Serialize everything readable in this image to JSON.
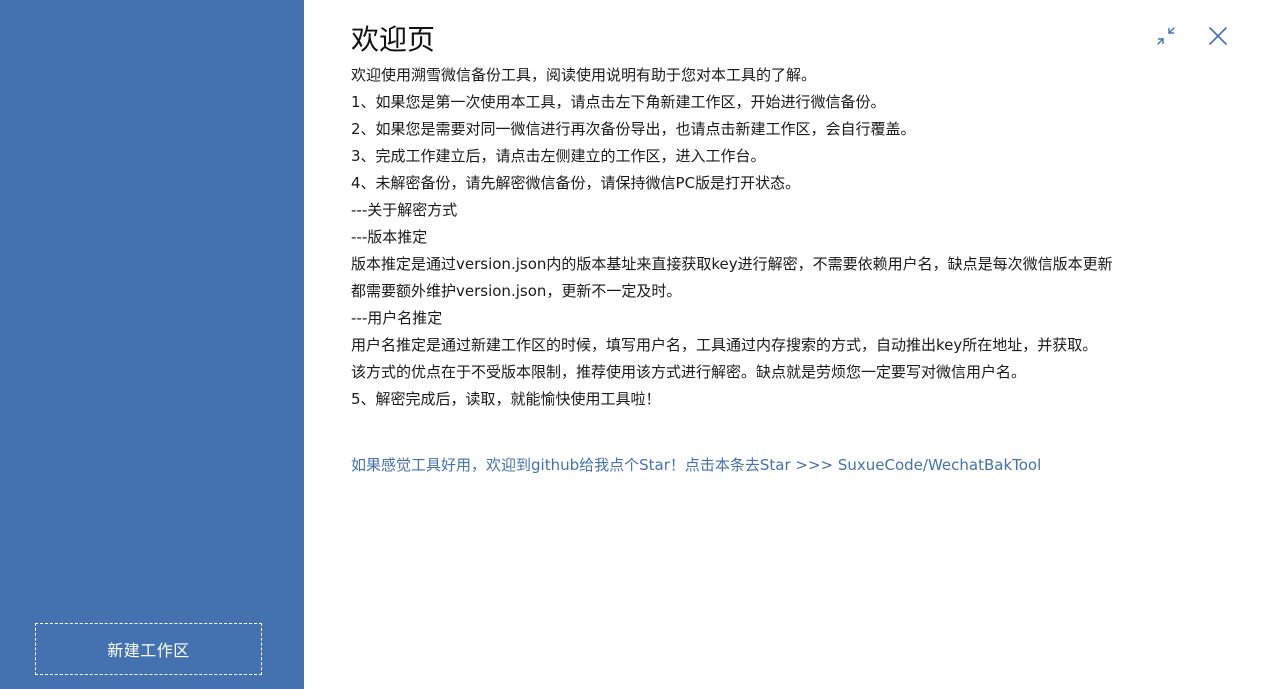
{
  "sidebar": {
    "new_workspace_label": "新建工作区",
    "color": "#4472b0"
  },
  "main": {
    "title": "欢迎页",
    "lines": [
      "欢迎使用溯雪微信备份工具，阅读使用说明有助于您对本工具的了解。",
      "1、如果您是第一次使用本工具，请点击左下角新建工作区，开始进行微信备份。",
      "2、如果您是需要对同一微信进行再次备份导出，也请点击新建工作区，会自行覆盖。",
      "3、完成工作建立后，请点击左侧建立的工作区，进入工作台。",
      "4、未解密备份，请先解密微信备份，请保持微信PC版是打开状态。",
      "---关于解密方式",
      "---版本推定",
      "版本推定是通过version.json内的版本基址来直接获取key进行解密，不需要依赖用户名，缺点是每次微信版本更新",
      "都需要额外维护version.json，更新不一定及时。",
      "---用户名推定",
      "用户名推定是通过新建工作区的时候，填写用户名，工具通过内存搜索的方式，自动推出key所在地址，并获取。",
      "该方式的优点在于不受版本限制，推荐使用该方式进行解密。缺点就是劳烦您一定要写对微信用户名。",
      "5、解密完成后，读取，就能愉快使用工具啦！"
    ],
    "star_link": "如果感觉工具好用，欢迎到github给我点个Star！点击本条去Star  >>>  SuxueCode/WechatBakTool",
    "link_color": "#4472b0"
  },
  "window": {
    "minimize_icon": "shrink-icon",
    "close_icon": "close-icon"
  }
}
